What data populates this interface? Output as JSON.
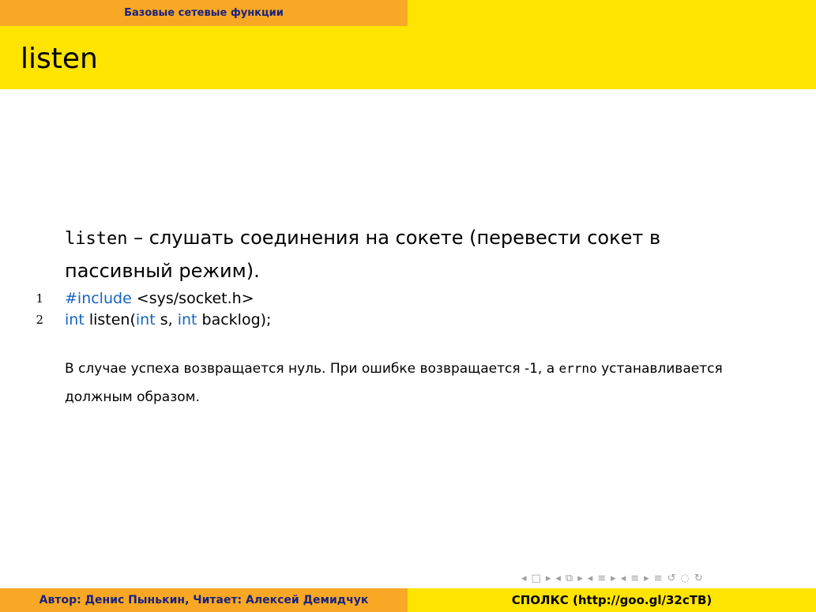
{
  "header": {
    "section": "Базовые сетевые функции",
    "title": "listen"
  },
  "content": {
    "lead_code": "listen",
    "lead_text_1": " – слушать соединения на сокете (перевести сокет в пассивный режим).",
    "code": [
      {
        "line": "1",
        "parts": [
          {
            "text": "#include",
            "kw": true
          },
          {
            "text": " <sys/socket.h>",
            "kw": false
          }
        ]
      },
      {
        "line": "2",
        "parts": [
          {
            "text": "int",
            "kw": true
          },
          {
            "text": " listen(",
            "kw": false
          },
          {
            "text": "int",
            "kw": true
          },
          {
            "text": " s, ",
            "kw": false
          },
          {
            "text": "int",
            "kw": true
          },
          {
            "text": " backlog);",
            "kw": false
          }
        ]
      }
    ],
    "para_1": "В случае успеха возвращается нуль. При ошибке возвращается -1, а ",
    "para_code": "errno",
    "para_2": " устанавливается должным образом."
  },
  "nav": {
    "symbols": [
      "◂",
      "□",
      "▸",
      "◂",
      "⧉",
      "▸",
      "◂",
      "≡",
      "▸",
      "◂",
      "≡",
      "▸",
      "≡",
      "↺",
      "◌",
      "↻"
    ]
  },
  "footer": {
    "left": "Автор: Денис Пынькин, Читает: Алексей Демидчук",
    "right": "СПОЛКС (http://goo.gl/32cTB)"
  }
}
